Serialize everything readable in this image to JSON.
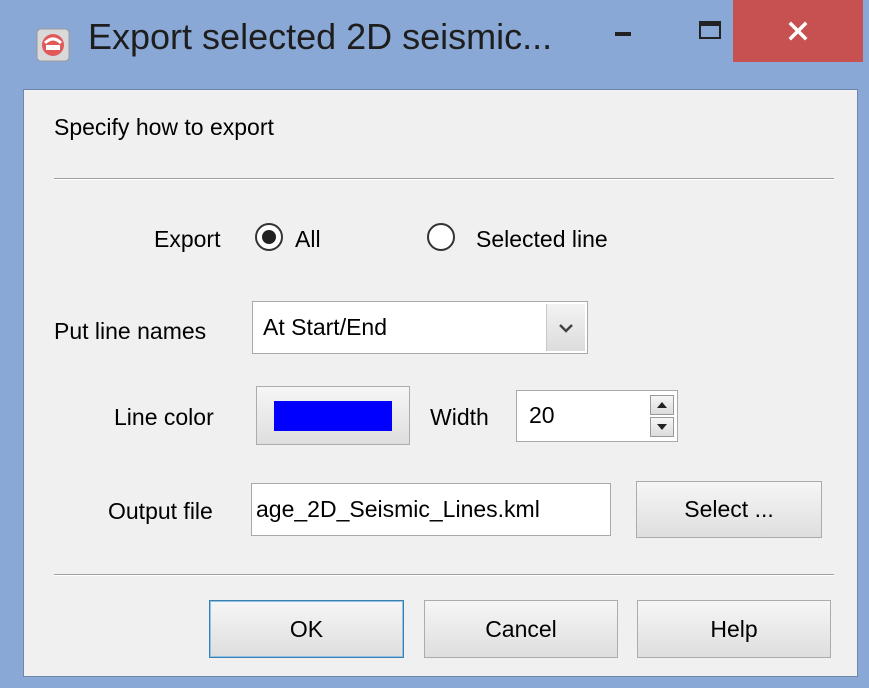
{
  "window": {
    "title": "Export selected 2D seismic..."
  },
  "dialog": {
    "heading": "Specify how to export",
    "export": {
      "label": "Export",
      "options": [
        {
          "label": "All",
          "selected": true
        },
        {
          "label": "Selected line",
          "selected": false
        }
      ]
    },
    "line_names": {
      "label": "Put line names",
      "value": "At Start/End"
    },
    "line_color": {
      "label": "Line color",
      "color": "#0000ff"
    },
    "width": {
      "label": "Width",
      "value": "20"
    },
    "output_file": {
      "label": "Output file",
      "value": "age_2D_Seismic_Lines.kml",
      "select_label": "Select ..."
    },
    "buttons": {
      "ok": "OK",
      "cancel": "Cancel",
      "help": "Help"
    }
  },
  "colors": {
    "close_button": "#c75050",
    "frame": "#8aa8d6"
  }
}
